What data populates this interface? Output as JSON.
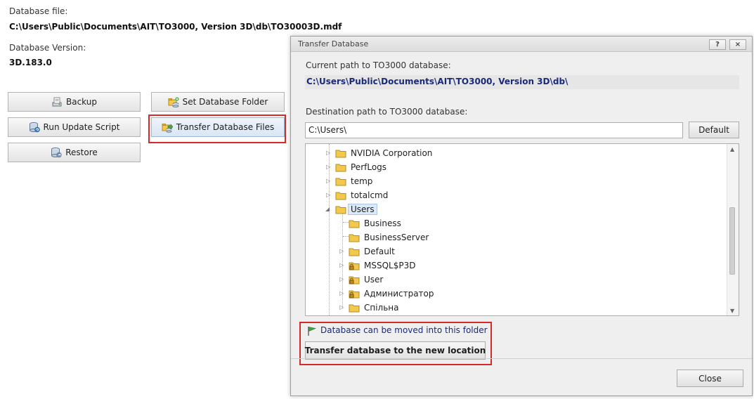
{
  "main": {
    "db_file_label": "Database file:",
    "db_file_path": "C:\\Users\\Public\\Documents\\AIT\\TO3000, Version 3D\\db\\TO30003D.mdf",
    "db_version_label": "Database Version:",
    "db_version": "3D.183.0",
    "buttons": {
      "backup": "Backup",
      "set_folder": "Set Database Folder",
      "run_update": "Run Update Script",
      "transfer_files": "Transfer Database Files",
      "restore": "Restore"
    }
  },
  "dialog": {
    "title": "Transfer Database",
    "help_btn": "?",
    "close_btn": "×",
    "current_path_label": "Current path to TO3000 database:",
    "current_path": "C:\\Users\\Public\\Documents\\AIT\\TO3000, Version 3D\\db\\",
    "dest_label": "Destination path to TO3000 database:",
    "dest_value": "C:\\Users\\",
    "default_btn": "Default",
    "tree": [
      {
        "label": "NVIDIA Corporation",
        "level": 0,
        "expander": "collapsed"
      },
      {
        "label": "PerfLogs",
        "level": 0,
        "expander": "collapsed"
      },
      {
        "label": "temp",
        "level": 0,
        "expander": "collapsed"
      },
      {
        "label": "totalcmd",
        "level": 0,
        "expander": "collapsed"
      },
      {
        "label": "Users",
        "level": 0,
        "expander": "expanded",
        "selected": true
      },
      {
        "label": "Business",
        "level": 1,
        "expander": "none"
      },
      {
        "label": "BusinessServer",
        "level": 1,
        "expander": "none"
      },
      {
        "label": "Default",
        "level": 1,
        "expander": "collapsed"
      },
      {
        "label": "MSSQL$P3D",
        "level": 1,
        "expander": "collapsed",
        "locked": true
      },
      {
        "label": "User",
        "level": 1,
        "expander": "collapsed",
        "locked": true
      },
      {
        "label": "Администратор",
        "level": 1,
        "expander": "collapsed",
        "locked": true
      },
      {
        "label": "Спільна",
        "level": 1,
        "expander": "collapsed"
      }
    ],
    "status_message": "Database can be moved into this folder",
    "transfer_btn": "Transfer database to the new location",
    "close_dialog_btn": "Close"
  },
  "colors": {
    "highlight_border": "#d42a2a",
    "path_text": "#1a2a7a",
    "folder": "#f2c94c"
  }
}
